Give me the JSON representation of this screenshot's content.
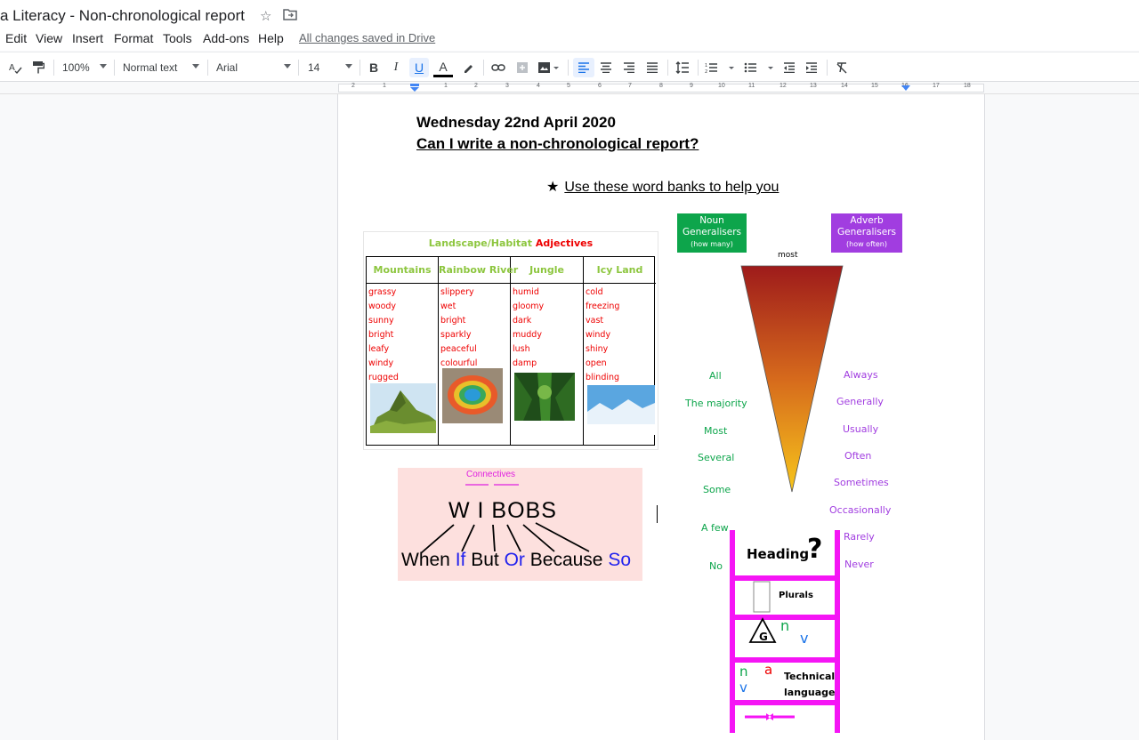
{
  "title_bar": {
    "doc_title": "a Literacy - Non-chronological report",
    "star_icon": "star-outline-icon",
    "move_icon": "move-to-folder-icon"
  },
  "menu": {
    "items": [
      "Edit",
      "View",
      "Insert",
      "Format",
      "Tools",
      "Add-ons",
      "Help"
    ],
    "saved_status": "All changes saved in Drive"
  },
  "toolbar": {
    "zoom": "100%",
    "style": "Normal text",
    "font": "Arial",
    "font_size": "14",
    "icons": [
      "spellcheck-icon",
      "paint-format-icon",
      "bold-icon",
      "italic-icon",
      "underline-icon",
      "text-color-icon",
      "highlight-icon",
      "link-icon",
      "comment-icon",
      "image-icon",
      "align-left-icon",
      "align-center-icon",
      "align-right-icon",
      "justify-icon",
      "line-spacing-icon",
      "numbered-list-icon",
      "bulleted-list-icon",
      "decrease-indent-icon",
      "increase-indent-icon",
      "clear-formatting-icon"
    ],
    "labels": {
      "bold": "B",
      "italic": "I",
      "underline": "U",
      "text_color": "A"
    },
    "accent_color": "#1a73e8"
  },
  "ruler": {
    "numbers": [
      "2",
      "1",
      "1",
      "2",
      "3",
      "4",
      "5",
      "6",
      "7",
      "8",
      "9",
      "10",
      "11",
      "12",
      "13",
      "14",
      "15",
      "16",
      "17",
      "18"
    ]
  },
  "document": {
    "date_heading": "Wednesday 22nd April 2020",
    "question_heading": "Can I write a non-chronological report?",
    "bullet_glyph": "★",
    "bullet_text": "Use these word banks to help you"
  },
  "adjectives_image": {
    "title_part1": "Landscape/Habitat",
    "title_part2": "Adjectives",
    "columns": [
      {
        "heading": "Mountains",
        "words": [
          "grassy",
          "woody",
          "sunny",
          "bright",
          "leafy",
          "windy",
          "rugged"
        ]
      },
      {
        "heading": "Rainbow River",
        "words": [
          "slippery",
          "wet",
          "bright",
          "sparkly",
          "peaceful",
          "colourful"
        ]
      },
      {
        "heading": "Jungle",
        "words": [
          "humid",
          "gloomy",
          "dark",
          "muddy",
          "lush",
          "damp"
        ]
      },
      {
        "heading": "Icy Land",
        "words": [
          "cold",
          "freezing",
          "vast",
          "windy",
          "shiny",
          "open",
          "blinding"
        ]
      }
    ],
    "colors": {
      "heading_green": "#8dc63f",
      "word_red": "#e00000"
    }
  },
  "generalisers_image": {
    "noun_box": {
      "line1": "Noun",
      "line2": "Generalisers",
      "line3": "(how many)"
    },
    "adverb_box": {
      "line1": "Adverb",
      "line2": "Generalisers",
      "line3": "(how often)"
    },
    "funnel_top_label": "most",
    "noun_words": [
      "All",
      "The majority",
      "Most",
      "Several",
      "Some",
      "A few",
      "No"
    ],
    "adverb_words": [
      "Always",
      "Generally",
      "Usually",
      "Often",
      "Sometimes",
      "Occasionally",
      "Rarely",
      "Never"
    ],
    "colors": {
      "noun": "#0da54b",
      "adverb": "#a13de0",
      "funnel_top": "#9e1b1b",
      "funnel_bottom": "#f7c61b"
    }
  },
  "connectives_image": {
    "title": "Connectives",
    "acronym": "W I BOBS",
    "words": [
      "When",
      "If",
      "But",
      "Or",
      "Because",
      "So"
    ],
    "colors": {
      "background": "#fde0de",
      "title": "#e020e0",
      "blue_word": "#2222ee"
    }
  },
  "ladder_image": {
    "heading": "Heading",
    "question_mark": "?",
    "plurals_label": "Plurals",
    "g_letter": "G",
    "n_letter": "n",
    "v_letter": "v",
    "a_letter": "a",
    "technical_line1": "Technical",
    "technical_line2": "language",
    "color": "#f515f5"
  }
}
